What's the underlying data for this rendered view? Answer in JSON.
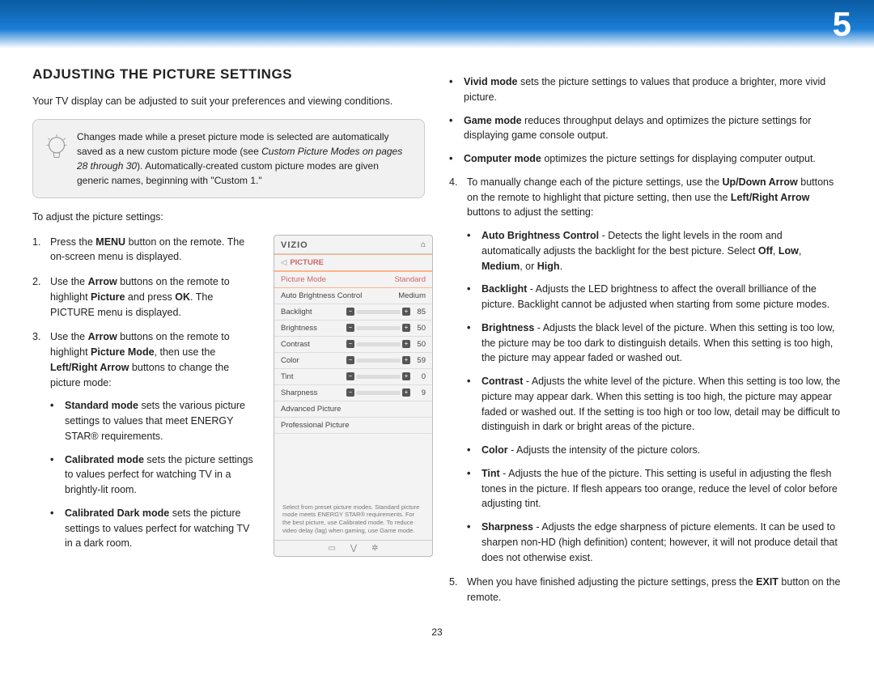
{
  "chapter": "5",
  "page_number": "23",
  "heading": "ADJUSTING THE PICTURE SETTINGS",
  "intro": "Your TV display can be adjusted to suit your preferences and viewing conditions.",
  "tip_a": "Changes made while a preset picture mode is selected are automatically saved as a new custom picture mode (see ",
  "tip_ref": "Custom Picture Modes on pages 28 through 30",
  "tip_b": "). Automatically-created custom picture modes are given generic names, beginning with \"Custom 1.\"",
  "lead": "To adjust the picture settings:",
  "step1": {
    "a": "Press the ",
    "b": "MENU",
    "c": " button on the remote. The on-screen menu is displayed."
  },
  "step2": {
    "a": "Use the ",
    "b": "Arrow",
    "c": " buttons on the remote to highlight ",
    "d": "Picture",
    "e": " and press ",
    "f": "OK",
    "g": ". The PICTURE menu is displayed."
  },
  "step3": {
    "a": "Use the ",
    "b": "Arrow",
    "c": " buttons on the remote to highlight ",
    "d": "Picture Mode",
    "e": ", then use the ",
    "f": "Left/Right Arrow",
    "g": " buttons to change the picture mode:"
  },
  "modes": {
    "standard": {
      "t": "Standard mode",
      "d": " sets the various picture settings to values that meet ENERGY STAR® requirements."
    },
    "calibrated": {
      "t": "Calibrated mode",
      "d": " sets the picture settings to values perfect for watching TV in a brightly-lit room."
    },
    "calibdark": {
      "t": "Calibrated Dark mode",
      "d": " sets the picture settings to values perfect for watching TV in a dark room."
    },
    "vivid": {
      "t": "Vivid mode",
      "d": " sets the picture settings to values that produce a brighter, more vivid picture."
    },
    "game": {
      "t": "Game mode",
      "d": " reduces throughput delays and optimizes the picture settings for displaying game console output."
    },
    "computer": {
      "t": "Computer mode",
      "d": " optimizes the picture settings for displaying computer output."
    }
  },
  "step4": {
    "a": "To manually change each of the picture settings, use the ",
    "b": "Up/Down Arrow",
    "c": " buttons on the remote to highlight that picture setting, then use the ",
    "d": "Left/Right Arrow",
    "e": " buttons to adjust the setting:"
  },
  "settings": {
    "abc": {
      "t": "Auto Brightness Control",
      "d": " - Detects the light levels in the room and automatically adjusts the backlight for the best picture. Select ",
      "opts": [
        "Off",
        "Low",
        "Medium",
        "High"
      ]
    },
    "bl": {
      "t": "Backlight",
      "d": " - Adjusts the LED brightness to affect the overall brilliance of the picture. Backlight cannot be adjusted when starting from some picture modes."
    },
    "br": {
      "t": "Brightness",
      "d": " - Adjusts the black level of the picture. When this setting is too low, the picture may be too dark to distinguish details. When this setting is too high, the picture may appear faded or washed out."
    },
    "ct": {
      "t": "Contrast",
      "d": " - Adjusts the white level of the picture. When this setting is too low, the picture may appear dark. When this setting is too high, the picture may appear faded or washed out. If the setting is too high or too low, detail may be difficult to distinguish in dark or bright areas of the picture."
    },
    "co": {
      "t": "Color",
      "d": " - Adjusts the intensity of the picture colors."
    },
    "ti": {
      "t": "Tint",
      "d": " - Adjusts the hue of the picture. This setting is useful in adjusting the flesh tones in the picture. If flesh appears too orange, reduce the level of color before adjusting tint."
    },
    "sh": {
      "t": "Sharpness",
      "d": " - Adjusts the edge sharpness of picture elements. It can be used to sharpen non-HD (high definition) content; however, it will not produce detail that does not otherwise exist."
    }
  },
  "step5": {
    "a": "When you have finished adjusting the picture settings, press the ",
    "b": "EXIT",
    "c": " button on the remote."
  },
  "osd": {
    "logo": "VIZIO",
    "breadcrumb": "PICTURE",
    "rows": [
      {
        "l": "Picture Mode",
        "v": "Standard",
        "hl": true,
        "slider": false
      },
      {
        "l": "Auto Brightness Control",
        "v": "Medium",
        "slider": false
      },
      {
        "l": "Backlight",
        "v": "85",
        "slider": true,
        "pct": 85
      },
      {
        "l": "Brightness",
        "v": "50",
        "slider": true,
        "pct": 50
      },
      {
        "l": "Contrast",
        "v": "50",
        "slider": true,
        "pct": 50
      },
      {
        "l": "Color",
        "v": "59",
        "slider": true,
        "pct": 59
      },
      {
        "l": "Tint",
        "v": "0",
        "slider": true,
        "pct": 50
      },
      {
        "l": "Sharpness",
        "v": "9",
        "slider": true,
        "pct": 9
      },
      {
        "l": "Advanced Picture",
        "v": "",
        "slider": false
      },
      {
        "l": "Professional Picture",
        "v": "",
        "slider": false
      }
    ],
    "help": "Select from preset picture modes. Standard picture mode meets ENERGY STAR® requirements. For the best picture, use Calibrated mode. To reduce video delay (lag) when gaming, use Game mode."
  }
}
